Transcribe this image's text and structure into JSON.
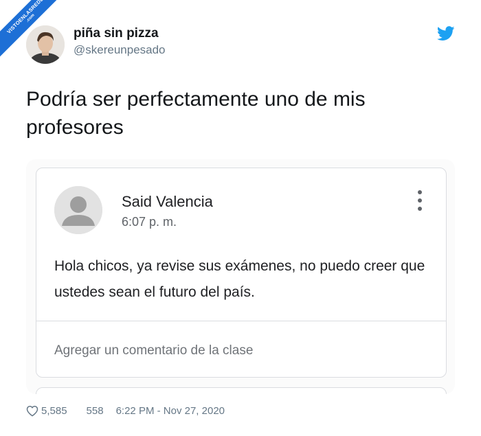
{
  "watermark": {
    "line1": "VISTOENLASREDES",
    "line2": ".com"
  },
  "author": {
    "display_name": "piña sin pizza",
    "handle": "@skereunpesado"
  },
  "tweet": {
    "text": "Podría ser perfectamente uno de mis profesores"
  },
  "embedded_post": {
    "author": "Said Valencia",
    "time": "6:07 p. m.",
    "body": "Hola chicos, ya revise sus exámenes, no puedo creer que ustedes sean el futuro del país.",
    "comment_placeholder": "Agregar un comentario de la clase"
  },
  "footer": {
    "likes": "5,585",
    "replies": "558",
    "timestamp": "6:22 PM - Nov 27, 2020"
  },
  "colors": {
    "twitter_blue": "#1da1f2",
    "ribbon_blue": "#1d6fd6",
    "muted_text": "#657786"
  },
  "icons": [
    "twitter-bird-icon",
    "heart-icon",
    "more-vert-icon",
    "person-placeholder-icon"
  ]
}
